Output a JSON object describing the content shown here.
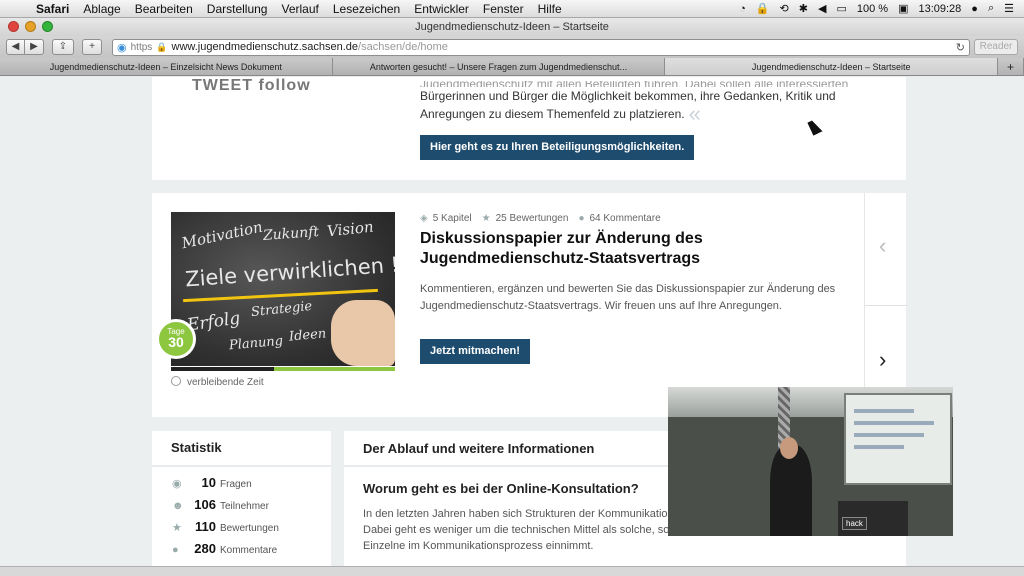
{
  "menubar": {
    "app": "Safari",
    "items": [
      "Ablage",
      "Bearbeiten",
      "Darstellung",
      "Verlauf",
      "Lesezeichen",
      "Entwickler",
      "Fenster",
      "Hilfe"
    ],
    "battery": "100 %",
    "clock": "13:09:28"
  },
  "window": {
    "title": "Jugendmedienschutz-Ideen – Startseite"
  },
  "toolbar": {
    "url_protocol": "https",
    "url_host": "www.jugendmedienschutz.sachsen.de",
    "url_path": "/sachsen/de/home",
    "reader_label": "Reader"
  },
  "tabs": [
    {
      "label": "Jugendmedienschutz-Ideen – Einzelsicht News Dokument"
    },
    {
      "label": "Antworten gesucht! – Unsere Fragen zum Jugendmedienschut..."
    },
    {
      "label": "Jugendmedienschutz-Ideen – Startseite"
    }
  ],
  "participation": {
    "intro": "Bürgerinnen und Bürger die Möglichkeit bekommen, ihre Gedanken, Kritik und Anregungen zu diesem Themenfeld zu platzieren.",
    "intro_top": "Jugendmedienschutz mit allen Beteiligten führen. Dabei sollen alle interessierten",
    "button": "Hier geht es zu Ihren Beteiligungsmöglichkeiten.",
    "logo_text": "TWEET follow"
  },
  "feature": {
    "chapters": "5 Kapitel",
    "ratings": "25 Bewertungen",
    "comments": "64 Kommentare",
    "title": "Diskussionspapier zur Änderung des Jugendmedienschutz-Staatsvertrags",
    "description": "Kommentieren, ergänzen und bewerten Sie das Diskussionspapier zur Änderung des Jugendmedienschutz-Staatsvertrags. Wir freuen uns auf Ihre Anregungen.",
    "button": "Jetzt mitmachen!",
    "days_label": "Tage",
    "days_value": "30",
    "remaining_label": "verbleibende Zeit",
    "time_elapsed_fraction": 0.46,
    "chalk": {
      "w1": "Motivation",
      "w2": "Zukunft",
      "w3": "Vision",
      "w4": "Ziele verwirklichen !",
      "w5": "Erfolg",
      "w6": "Strategie",
      "w7": "Planung",
      "w8": "Ideen"
    }
  },
  "stats": {
    "title": "Statistik",
    "rows": [
      {
        "value": "10",
        "label": "Fragen"
      },
      {
        "value": "106",
        "label": "Teilnehmer"
      },
      {
        "value": "110",
        "label": "Bewertungen"
      },
      {
        "value": "280",
        "label": "Kommentare"
      }
    ]
  },
  "info": {
    "title": "Der Ablauf und weitere Informationen",
    "subtitle": "Worum geht es bei der Online-Konsultation?",
    "text": "In den letzten Jahren haben sich Strukturen der Kommunikation grundlegend entscheidend verändert. Dabei geht es weniger um die technischen Mittel als solche, sondern vielmehr um die Rolle, die der Einzelne im Kommunikationsprozess einnimmt."
  },
  "video": {
    "badge": "hack"
  },
  "colors": {
    "accent": "#1e4c6e",
    "green": "#8dc63f"
  }
}
